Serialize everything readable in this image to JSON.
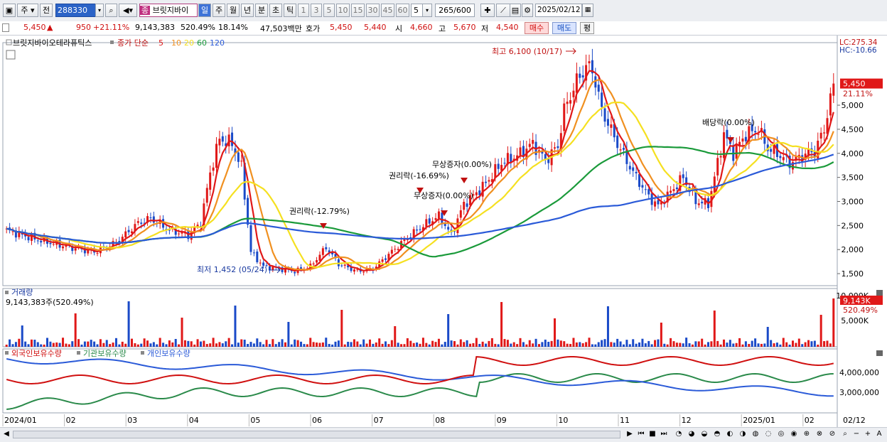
{
  "toolbar": {
    "mode_label": "주",
    "prev_label": "전",
    "code_value": "288330",
    "stock_name": "브릿지바이",
    "stock_badge": "종",
    "period_tabs": [
      "일",
      "주",
      "월",
      "년",
      "분",
      "초",
      "틱"
    ],
    "interval_tabs": [
      "1",
      "3",
      "5",
      "10",
      "15",
      "30",
      "45",
      "60"
    ],
    "interval_select": "5",
    "count_value": "265",
    "count_max": "/600",
    "date_value": "2025/02/12"
  },
  "info": {
    "price": "5,450",
    "change": "950",
    "change_pct": "+21.11%",
    "volume": "9,143,383",
    "volume_pct": "520.49%",
    "turnover_pct": "18.14%",
    "amount": "47,503백만",
    "bid_label": "호가",
    "bid_ask": "5,450",
    "bid_bid": "5,440",
    "open_label": "시",
    "open": "4,660",
    "high_label": "고",
    "high": "5,670",
    "low_label": "저",
    "low": "4,540",
    "buy_label": "매수",
    "sell_label": "매도",
    "avg_label": "평"
  },
  "chart_data": [
    {
      "type": "candlestick",
      "title": "브릿지바이오테라퓨틱스",
      "legend": {
        "price_label": "종가 단순",
        "ma_periods": [
          "5",
          "10",
          "20",
          "60",
          "120"
        ],
        "ma_colors": [
          "#e01818",
          "#f09020",
          "#f5e020",
          "#1a9a3a",
          "#2a5ad8"
        ]
      },
      "y_ticks": [
        "5,000",
        "4,500",
        "4,000",
        "3,500",
        "3,000",
        "2,500",
        "2,000",
        "1,500"
      ],
      "ylim": [
        1250,
        6300
      ],
      "x_ticks": [
        "2024/01",
        "02",
        "03",
        "04",
        "05",
        "06",
        "07",
        "08",
        "09",
        "10",
        "11",
        "12",
        "2025/01",
        "02",
        "02/12"
      ],
      "lc": "LC:275.34",
      "hc": "HC:-10.66",
      "last_price": "5,450",
      "last_pct": "21.11%",
      "annotations": {
        "high": "최고 6,100 (10/17)",
        "low": "최저 1,452 (05/24)",
        "rights1": "권리락(-12.79%)",
        "rights2": "권리락(-16.69%)",
        "bonus1": "무상증자(0.00%)",
        "bonus2": "무상증자(0.00%)",
        "dividend": "배당락(0.00%)"
      },
      "close_keypoints": [
        [
          0,
          2400
        ],
        [
          10,
          2200
        ],
        [
          20,
          2050
        ],
        [
          28,
          1950
        ],
        [
          35,
          2150
        ],
        [
          42,
          2550
        ],
        [
          46,
          2650
        ],
        [
          52,
          2400
        ],
        [
          58,
          2300
        ],
        [
          62,
          2550
        ],
        [
          65,
          3600
        ],
        [
          68,
          4300
        ],
        [
          72,
          4200
        ],
        [
          75,
          3700
        ],
        [
          78,
          1950
        ],
        [
          82,
          1650
        ],
        [
          87,
          1600
        ],
        [
          92,
          1550
        ],
        [
          97,
          1650
        ],
        [
          102,
          2050
        ],
        [
          106,
          1700
        ],
        [
          112,
          1550
        ],
        [
          117,
          1600
        ],
        [
          122,
          1900
        ],
        [
          128,
          2250
        ],
        [
          133,
          2500
        ],
        [
          138,
          2700
        ],
        [
          142,
          2300
        ],
        [
          146,
          2950
        ],
        [
          152,
          3300
        ],
        [
          158,
          3800
        ],
        [
          163,
          3950
        ],
        [
          168,
          4200
        ],
        [
          172,
          3850
        ],
        [
          176,
          4150
        ],
        [
          178,
          4900
        ],
        [
          182,
          5500
        ],
        [
          185,
          5800
        ],
        [
          187,
          5750
        ],
        [
          190,
          4900
        ],
        [
          195,
          4200
        ],
        [
          200,
          3600
        ],
        [
          205,
          3100
        ],
        [
          208,
          2900
        ],
        [
          212,
          3200
        ],
        [
          216,
          3500
        ],
        [
          220,
          3000
        ],
        [
          224,
          2950
        ],
        [
          226,
          3500
        ],
        [
          229,
          4400
        ],
        [
          232,
          4000
        ],
        [
          236,
          4400
        ],
        [
          240,
          4500
        ],
        [
          243,
          4100
        ],
        [
          246,
          4000
        ],
        [
          250,
          3800
        ],
        [
          254,
          3950
        ],
        [
          258,
          4050
        ],
        [
          261,
          4500
        ],
        [
          264,
          5450
        ]
      ],
      "volume_panel": {
        "title": "거래량",
        "label": "9,143,383주(520.49%)",
        "y_ticks": [
          "10,000K",
          "5,000K"
        ],
        "last": "9,143K",
        "last_pct": "520.49%"
      }
    },
    {
      "type": "line",
      "series": [
        {
          "name": "외국인보유수량",
          "color": "#d01010"
        },
        {
          "name": "기관보유수량",
          "color": "#2a8a4a"
        },
        {
          "name": "개인보유수량",
          "color": "#2a5ad8"
        }
      ],
      "y_ticks": [
        "4,000,000",
        "3,000,000"
      ]
    }
  ],
  "colors": {
    "up": "#e01818",
    "down": "#1a4ac8",
    "accent": "#2b63c7"
  }
}
